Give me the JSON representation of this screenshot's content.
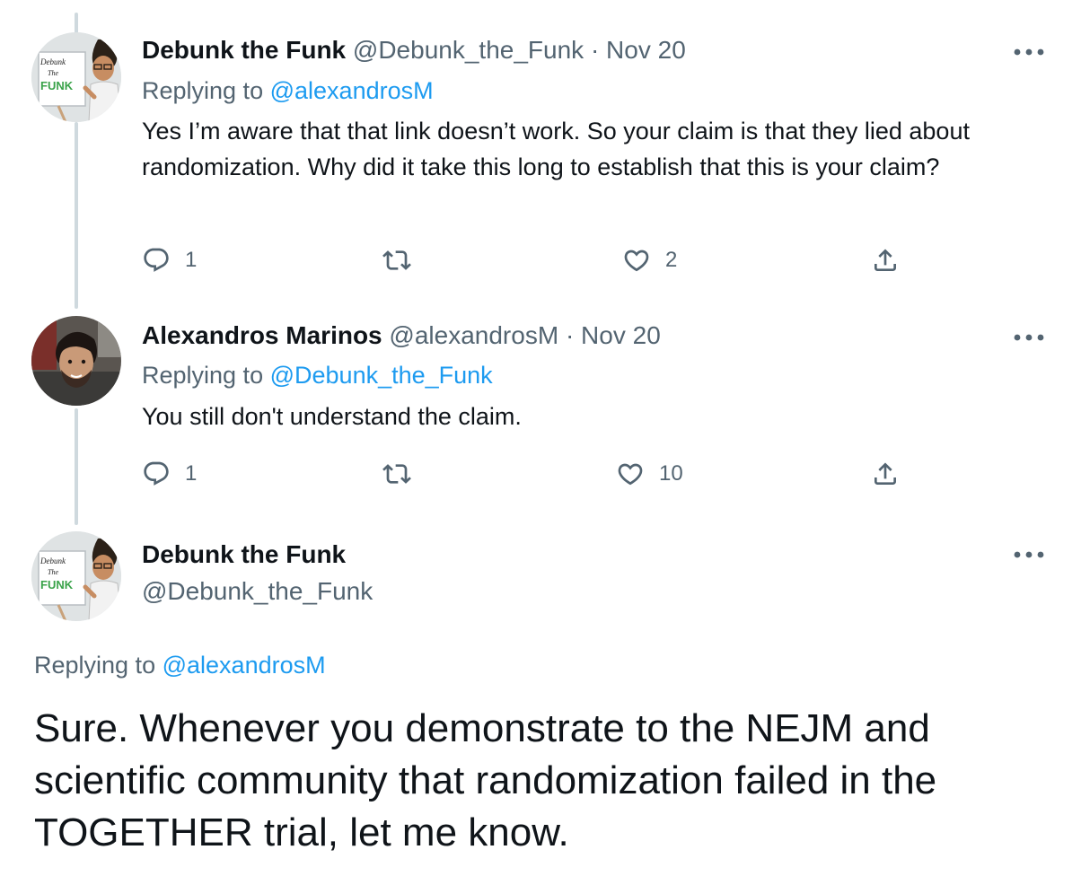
{
  "tweets": [
    {
      "name": "Debunk the Funk",
      "handle": "@Debunk_the_Funk",
      "dot": "·",
      "date": "Nov 20",
      "replying_prefix": "Replying to",
      "replying_to": "@alexandrosM",
      "text": "Yes I’m aware that that link doesn’t work. So your claim is that they lied about randomization. Why did it take this long to establish that this is your claim?",
      "reply_count": "1",
      "like_count": "2"
    },
    {
      "name": "Alexandros Marinos",
      "handle": "@alexandrosM",
      "dot": "·",
      "date": "Nov 20",
      "replying_prefix": "Replying to",
      "replying_to": "@Debunk_the_Funk",
      "text": "You still don't understand the claim.",
      "reply_count": "1",
      "like_count": "10"
    }
  ],
  "focused": {
    "name": "Debunk the Funk",
    "handle": "@Debunk_the_Funk",
    "replying_prefix": "Replying to",
    "replying_to": "@alexandrosM",
    "text": "Sure. Whenever you demonstrate to the NEJM and scientific community that randomization failed in the TOGETHER trial, let me know."
  },
  "logo_text": [
    "Debunk",
    "The",
    "FUNK"
  ],
  "icons": [
    "reply-icon",
    "retweet-icon",
    "like-icon",
    "share-icon",
    "more-icon"
  ],
  "colors": {
    "link": "#1d9bf0",
    "secondary": "#536471",
    "thread_line": "#cfd9de",
    "text": "#0f1419"
  }
}
